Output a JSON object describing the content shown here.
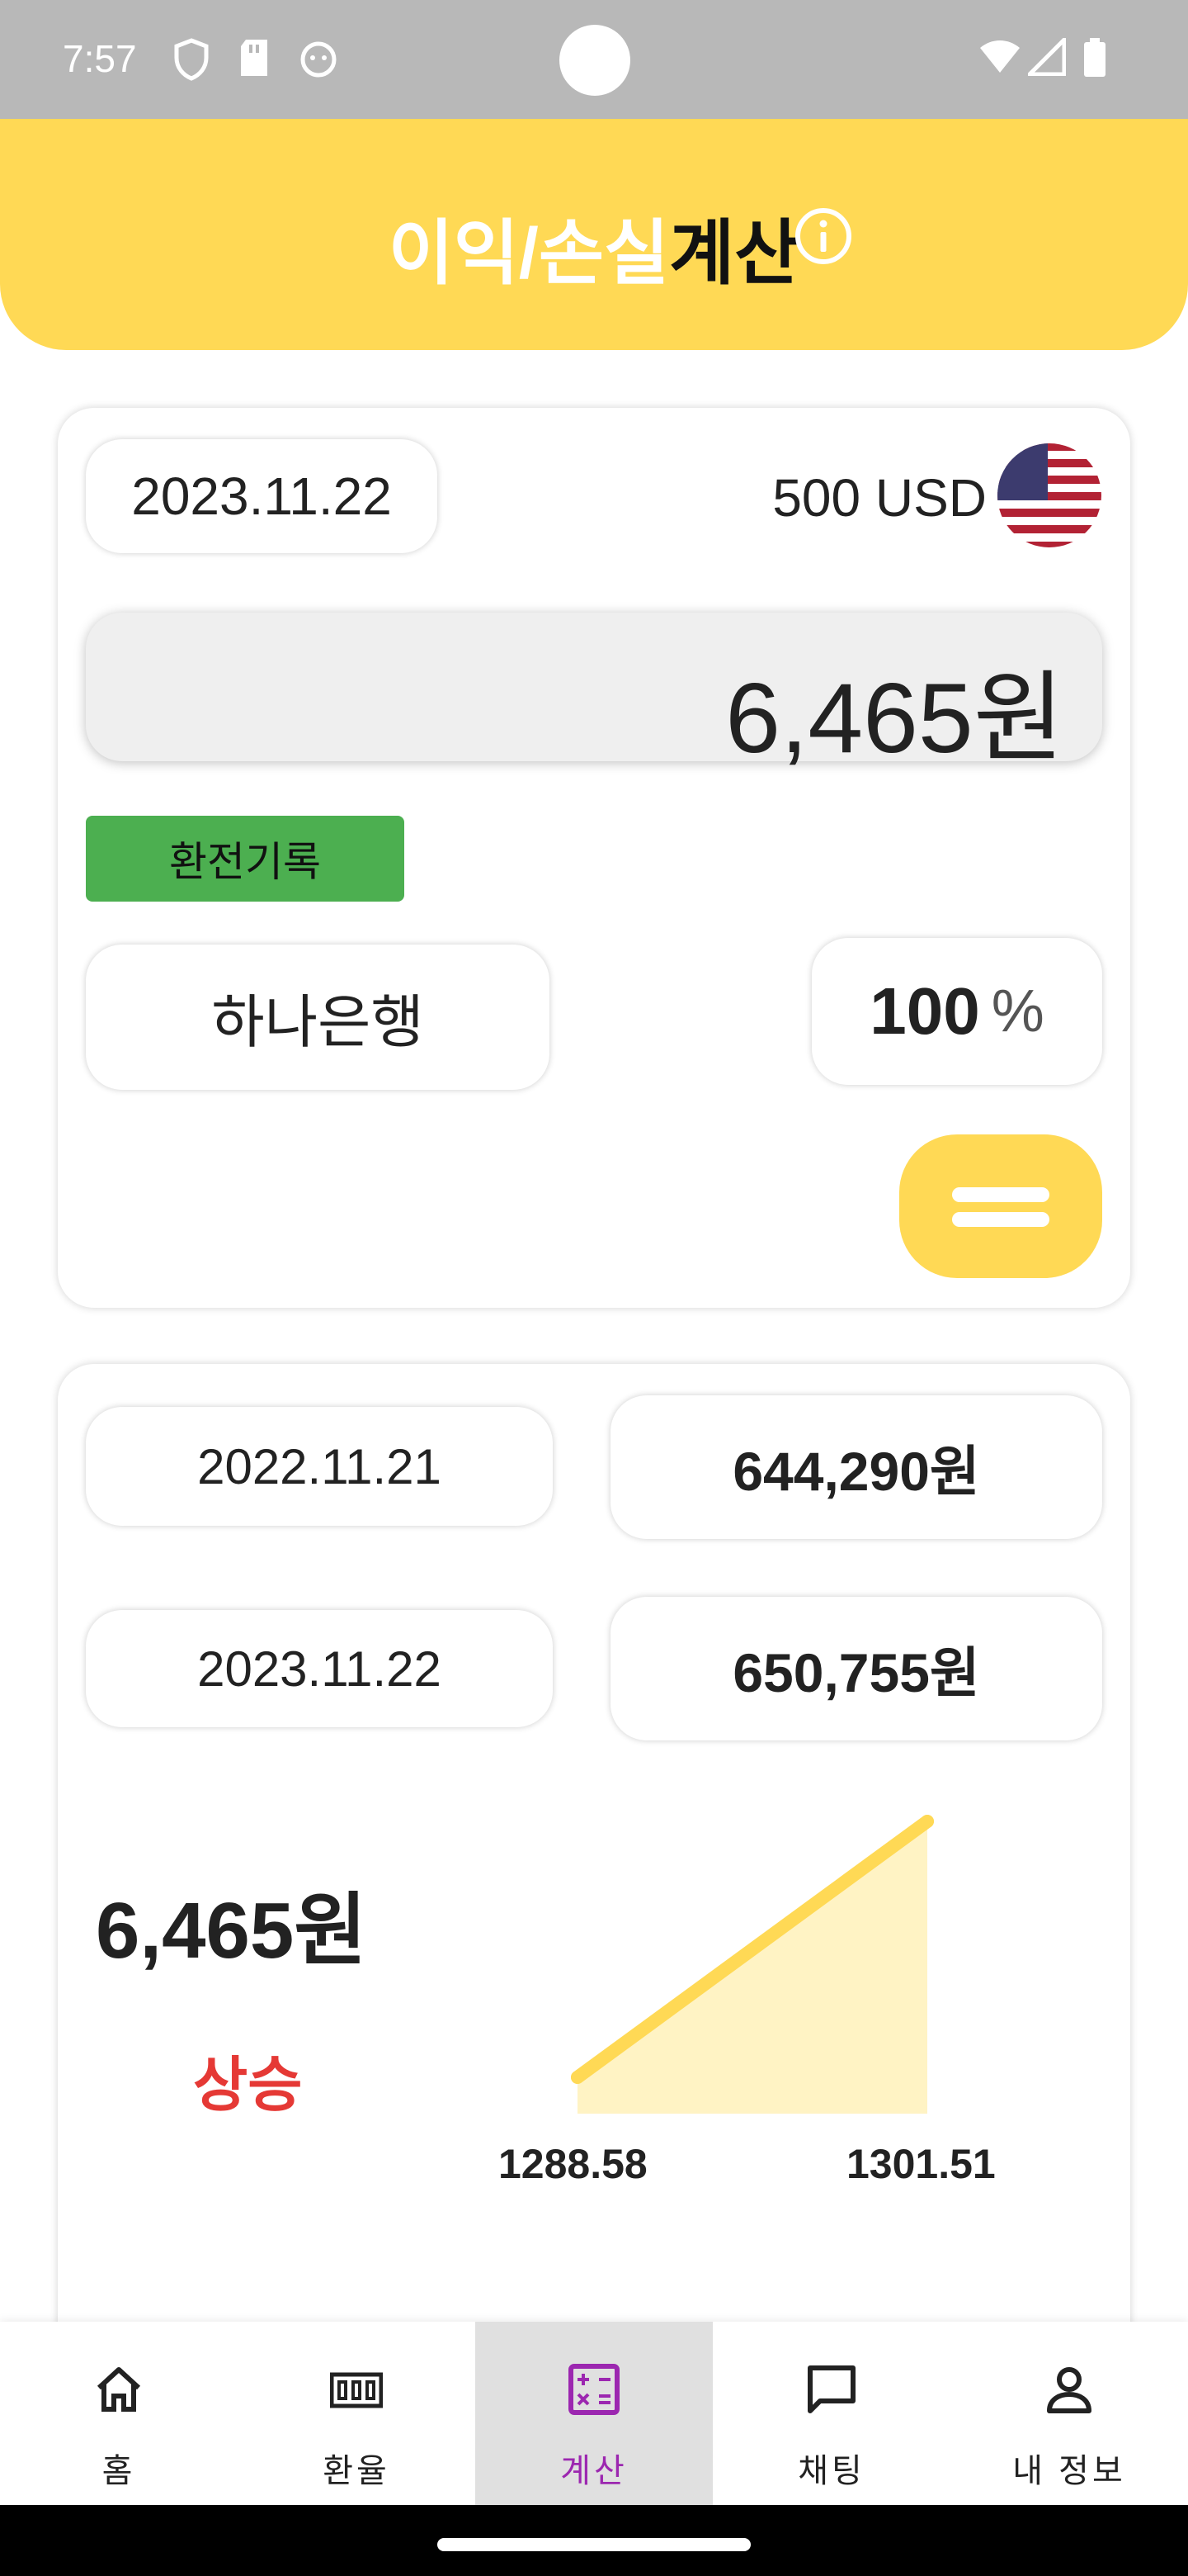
{
  "status_bar": {
    "time": "7:57"
  },
  "header": {
    "title_white": "이익/손실",
    "title_black": "계산"
  },
  "calc_card": {
    "date": "2023.11.22",
    "amount_label": "500 USD",
    "profit": "6,465원",
    "record_tag": "환전기록",
    "bank": "하나은행",
    "rate_percent": "100",
    "percent_sign": "%"
  },
  "compare_card": {
    "rows": [
      {
        "date": "2022.11.21",
        "value": "644,290원"
      },
      {
        "date": "2023.11.22",
        "value": "650,755원"
      }
    ],
    "difference": "6,465원",
    "trend_label": "상승"
  },
  "chart_data": {
    "type": "area",
    "x": [
      "2022.11.21",
      "2023.11.22"
    ],
    "values": [
      1288.58,
      1301.51
    ],
    "tick_labels": [
      "1288.58",
      "1301.51"
    ],
    "line_color": "#FFD955",
    "fill_color": "#FFF3C4"
  },
  "bottom_nav": [
    {
      "label": "홈",
      "icon": "home-icon"
    },
    {
      "label": "환율",
      "icon": "currency-icon"
    },
    {
      "label": "계산",
      "icon": "calculator-icon",
      "active": true
    },
    {
      "label": "채팅",
      "icon": "chat-icon"
    },
    {
      "label": "내 정보",
      "icon": "person-icon"
    }
  ],
  "colors": {
    "accent": "#FFD955",
    "green": "#4CAF50",
    "rise": "#E53935",
    "active_nav": "#9C27B0"
  }
}
